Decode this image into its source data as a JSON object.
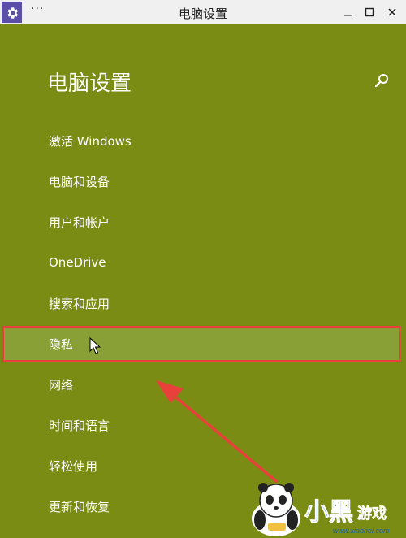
{
  "window": {
    "title": "电脑设置",
    "more_glyph": "···"
  },
  "header": {
    "title": "电脑设置"
  },
  "menu": {
    "items": [
      {
        "label": "激活 Windows"
      },
      {
        "label": "电脑和设备"
      },
      {
        "label": "用户和帐户"
      },
      {
        "label": "OneDrive"
      },
      {
        "label": "搜索和应用"
      },
      {
        "label": "隐私",
        "selected": true
      },
      {
        "label": "网络"
      },
      {
        "label": "时间和语言"
      },
      {
        "label": "轻松使用"
      },
      {
        "label": "更新和恢复"
      }
    ]
  },
  "icons": {
    "app": "gear-icon",
    "minimize": "minimize-icon",
    "maximize": "maximize-icon",
    "close": "close-icon",
    "search": "search-icon",
    "cursor": "mouse-cursor-icon"
  },
  "colors": {
    "background": "#7a8c14",
    "selected_bg": "#89a036",
    "highlight_border": "#e8413c",
    "arrow": "#e8413c",
    "app_icon_bg": "#5b4ea6"
  },
  "watermark": {
    "text": "小黑游戏",
    "url": "www.xiaohei.com"
  }
}
